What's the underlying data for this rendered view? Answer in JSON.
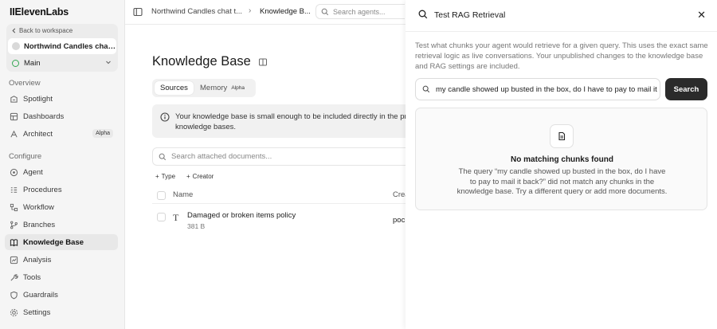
{
  "sidebar": {
    "logo": "IIElevenLabs",
    "back_label": "Back to workspace",
    "agent_name": "Northwind Candles chat t...",
    "branch": "Main",
    "overview_title": "Overview",
    "overview_items": [
      {
        "label": "Spotlight",
        "icon": "spotlight-icon"
      },
      {
        "label": "Dashboards",
        "icon": "dashboard-icon"
      },
      {
        "label": "Architect",
        "icon": "architect-icon",
        "badge": "Alpha"
      }
    ],
    "configure_title": "Configure",
    "configure_items": [
      {
        "label": "Agent",
        "icon": "agent-icon"
      },
      {
        "label": "Procedures",
        "icon": "procedures-icon"
      },
      {
        "label": "Workflow",
        "icon": "workflow-icon"
      },
      {
        "label": "Branches",
        "icon": "branches-icon"
      },
      {
        "label": "Knowledge Base",
        "icon": "book-icon",
        "active": true
      },
      {
        "label": "Analysis",
        "icon": "analysis-icon"
      },
      {
        "label": "Tools",
        "icon": "tools-icon"
      },
      {
        "label": "Guardrails",
        "icon": "shield-icon"
      },
      {
        "label": "Settings",
        "icon": "gear-icon"
      }
    ]
  },
  "topbar": {
    "crumb1": "Northwind Candles chat t...",
    "crumb2": "Knowledge B...",
    "search_placeholder": "Search agents..."
  },
  "main": {
    "title": "Knowledge Base",
    "tabs": [
      {
        "label": "Sources",
        "active": true
      },
      {
        "label": "Memory",
        "badge": "Alpha"
      }
    ],
    "callout": "Your knowledge base is small enough to be included directly in the pro knowledge bases.",
    "doc_search_placeholder": "Search attached documents...",
    "filters": [
      "Type",
      "Creator"
    ],
    "columns": {
      "name": "Name",
      "created": "Crea"
    },
    "rows": [
      {
        "name": "Damaged or broken items policy",
        "size": "381 B",
        "creator": "poc"
      }
    ]
  },
  "panel": {
    "title": "Test RAG Retrieval",
    "description": "Test what chunks your agent would retrieve for a given query. This uses the exact same retrieval logic as live conversations. Your unpublished changes to the knowledge base and RAG settings are included.",
    "query": "my candle showed up busted in the box, do I have to pay to mail it b",
    "search_label": "Search",
    "result_title": "No matching chunks found",
    "result_text": "The query “my candle showed up busted in the box, do I have to pay to mail it back?” did not match any chunks in the knowledge base. Try a different query or add more documents."
  },
  "colors": {
    "sidebar_bg": "#f5f5f5",
    "active_item_bg": "#e8e8e8",
    "branch_green": "#34a853",
    "button_dark": "#2b2b2b"
  }
}
